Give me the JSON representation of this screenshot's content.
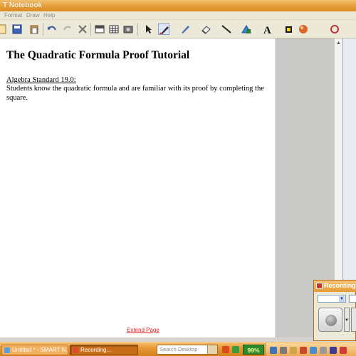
{
  "window": {
    "title": "T Notebook"
  },
  "menu": [
    "Format",
    "Draw",
    "Help"
  ],
  "toolbar": {
    "icons": [
      "new-page-icon",
      "save-icon",
      "paste-icon",
      "undo-icon",
      "redo-icon",
      "delete-icon",
      "screen-shade-icon",
      "table-icon",
      "capture-icon",
      "select-icon",
      "pen-icon",
      "creative-pen-icon",
      "eraser-icon",
      "line-icon",
      "shape-icon",
      "text-icon",
      "fill-icon",
      "properties-icon",
      "move-toolbar-icon"
    ]
  },
  "document": {
    "title": "The Quadratic Formula Proof Tutorial",
    "standard": "Algebra Standard 19.0:",
    "body": "Students know the quadratic formula and are familiar with its proof by completing the square.",
    "extend_page": "Extend Page"
  },
  "recorder": {
    "title": "Recording..."
  },
  "taskbar": {
    "tasks": [
      {
        "label": "Untitled * - SMART N...",
        "icon": "smart-notebook-icon"
      },
      {
        "label": "Recording...",
        "icon": "recorder-icon"
      }
    ],
    "search_placeholder": "Search Desktop",
    "battery": "99%"
  },
  "colors": {
    "titlebar": "#e8a440",
    "document_bg": "#ffffff",
    "panel_bg": "#c9c9c7",
    "extend_link": "#e02020",
    "battery": "#2f8a2a"
  }
}
